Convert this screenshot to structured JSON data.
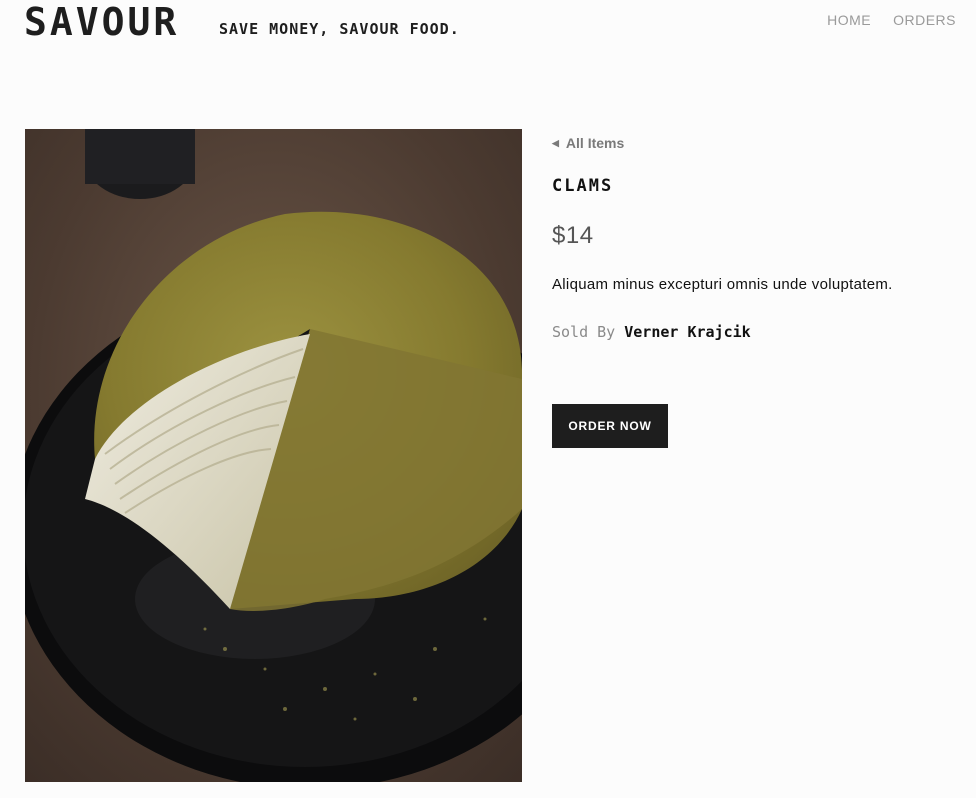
{
  "header": {
    "brand": "SAVOUR",
    "tagline": "SAVE MONEY, SAVOUR FOOD.",
    "nav": [
      {
        "label": "HOME"
      },
      {
        "label": "ORDERS"
      }
    ]
  },
  "product": {
    "back_label": "All Items",
    "back_icon": "caret-left-icon",
    "name": "CLAMS",
    "price": "$14",
    "description": "Aliquam minus excepturi omnis unde voluptatem.",
    "sold_by_label": "Sold By",
    "seller": "Verner Krajcik",
    "order_button": "ORDER NOW",
    "image_alt": "matcha crepe cake"
  },
  "colors": {
    "background": "#fcfcfc",
    "button": "#1e1e1e",
    "muted": "#9a9a9a"
  }
}
